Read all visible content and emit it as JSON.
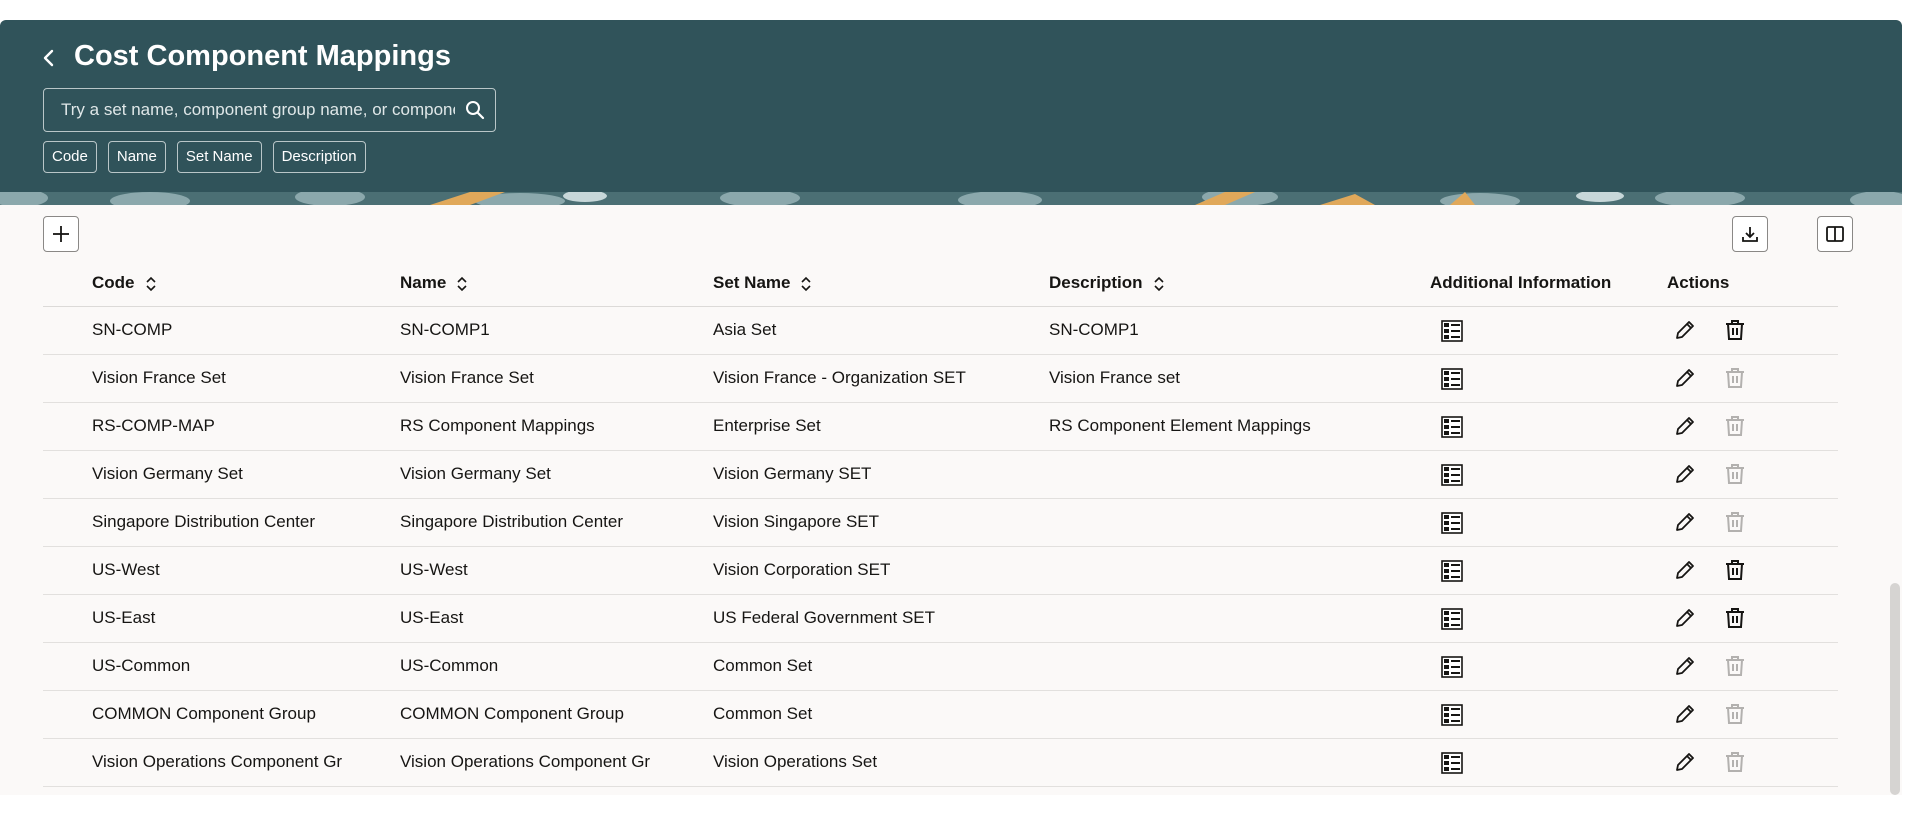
{
  "header": {
    "title": "Cost Component Mappings",
    "search_placeholder": "Try a set name, component group name, or component",
    "filters": [
      "Code",
      "Name",
      "Set Name",
      "Description"
    ]
  },
  "table": {
    "columns": {
      "code": "Code",
      "name": "Name",
      "set_name": "Set Name",
      "description": "Description",
      "additional_information": "Additional Information",
      "actions": "Actions"
    },
    "rows": [
      {
        "code": "SN-COMP",
        "name": "SN-COMP1",
        "set_name": "Asia Set",
        "description": "SN-COMP1",
        "delete_enabled": true
      },
      {
        "code": "Vision France Set",
        "name": "Vision France Set",
        "set_name": "Vision France - Organization SET",
        "description": "Vision France set",
        "delete_enabled": false
      },
      {
        "code": "RS-COMP-MAP",
        "name": "RS Component Mappings",
        "set_name": "Enterprise Set",
        "description": "RS Component Element Mappings",
        "delete_enabled": false
      },
      {
        "code": "Vision Germany Set",
        "name": "Vision Germany Set",
        "set_name": "Vision Germany SET",
        "description": "",
        "delete_enabled": false
      },
      {
        "code": "Singapore Distribution Center",
        "name": "Singapore Distribution Center",
        "set_name": "Vision Singapore SET",
        "description": "",
        "delete_enabled": false
      },
      {
        "code": "US-West",
        "name": "US-West",
        "set_name": "Vision Corporation SET",
        "description": "",
        "delete_enabled": true
      },
      {
        "code": "US-East",
        "name": "US-East",
        "set_name": "US Federal Government SET",
        "description": "",
        "delete_enabled": true
      },
      {
        "code": "US-Common",
        "name": "US-Common",
        "set_name": "Common Set",
        "description": "",
        "delete_enabled": false
      },
      {
        "code": "COMMON Component Group",
        "name": "COMMON Component Group",
        "set_name": "Common Set",
        "description": "",
        "delete_enabled": false
      },
      {
        "code": "Vision Operations Component Gr",
        "name": "Vision Operations Component Gr",
        "set_name": "Vision Operations Set",
        "description": "",
        "delete_enabled": false
      }
    ]
  },
  "icons": {
    "back": "chevron-left-icon",
    "search": "search-icon",
    "add": "plus-icon",
    "export": "download-icon",
    "columns": "column-layout-icon",
    "details": "detail-list-icon",
    "edit": "pencil-icon",
    "delete": "trash-icon"
  },
  "colors": {
    "header_bg": "#30535a",
    "page_bg": "#fbf9f8",
    "disabled_icon": "#b3b1af"
  }
}
